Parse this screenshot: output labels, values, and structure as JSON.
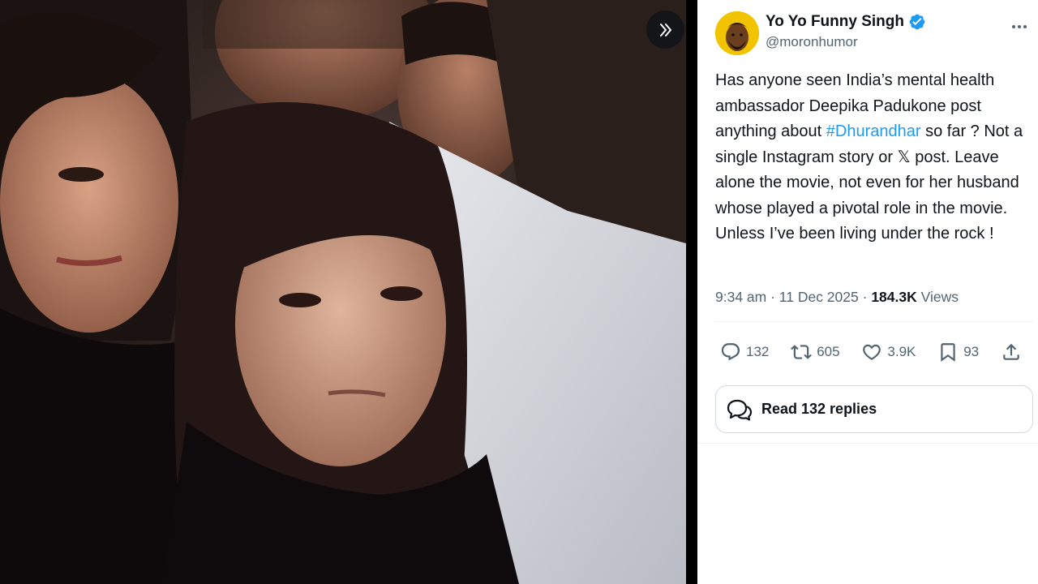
{
  "author": {
    "display_name": "Yo Yo Funny Singh",
    "handle": "@moronhumor"
  },
  "tweet": {
    "text_before": "Has anyone seen India’s mental health ambassador Deepika Padukone post anything about ",
    "hashtag": "#Dhurandhar",
    "text_after": " so far ? Not a single Instagram story or 𝕏 post. Leave alone the movie, not even for her husband whose played a pivotal role in the movie. Unless I’ve been living under the rock !"
  },
  "meta": {
    "time": "9:34 am",
    "dot": " · ",
    "date": "11 Dec 2025",
    "dot2": " · ",
    "views_count": "184.3K",
    "views_label": " Views"
  },
  "actions": {
    "replies": "132",
    "reposts": "605",
    "likes": "3.9K",
    "bookmarks": "93"
  },
  "read_replies_label": "Read 132 replies",
  "colors": {
    "accent": "#1d9bf0",
    "text": "#0f1419",
    "secondary": "#536471",
    "avatar_bg": "#f2c400"
  },
  "icons": [
    "expand-icon",
    "verified-icon",
    "more-icon",
    "reply-icon",
    "repost-icon",
    "like-icon",
    "bookmark-icon",
    "share-icon",
    "chat-bubbles-icon"
  ]
}
